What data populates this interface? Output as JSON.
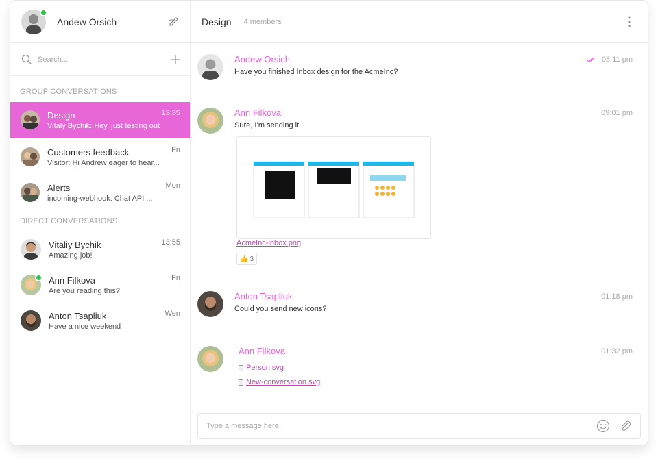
{
  "user": {
    "name": "Andew Orsich",
    "status": "online"
  },
  "search": {
    "placeholder": "Search..."
  },
  "sections": {
    "group": "GROUP CONVERSATIONS",
    "direct": "DIRECT CONVERSATIONS"
  },
  "group_conversations": [
    {
      "title": "Design",
      "subtitle": "Vitaly Bychik: Hey, just testing out",
      "time": "13:35",
      "active": true
    },
    {
      "title": "Customers feedback",
      "subtitle": "Visitor: Hi Andrew eager to hear...",
      "time": "Fri"
    },
    {
      "title": "Alerts",
      "subtitle": "incoming-webhook: Chat API ...",
      "time": "Mon"
    }
  ],
  "direct_conversations": [
    {
      "title": "Vitaliy Bychik",
      "subtitle": "Amazing job!",
      "time": "13:55"
    },
    {
      "title": "Ann Filkova",
      "subtitle": "Are you reading this?",
      "time": "Fri",
      "online": true
    },
    {
      "title": "Anton Tsapliuk",
      "subtitle": "Have a nice weekend",
      "time": "Wen"
    }
  ],
  "chat": {
    "title": "Design",
    "members": "4 members"
  },
  "messages": [
    {
      "author": "Andew Orsich",
      "time": "08:11 pm",
      "text": "Have you finished Inbox design for the AcmeInc?",
      "read": true
    },
    {
      "author": "Ann Filkova",
      "time": "09:01 pm",
      "text": "Sure, I’m sending it",
      "attachment": "AcmeInc-inbox.png",
      "reaction": {
        "emoji": "👍",
        "count": "3"
      }
    },
    {
      "author": "Anton Tsapliuk",
      "time": "01:18 pm",
      "text": "Could you send new icons?"
    },
    {
      "author": "Ann Filkova",
      "time": "01:32 pm",
      "files": [
        "Person.svg",
        "New-conversation.svg"
      ]
    }
  ],
  "composer": {
    "placeholder": "Type a message here..."
  },
  "colors": {
    "accent": "#e766d8",
    "online": "#2ac54a",
    "link": "#b14fa6"
  },
  "icons": [
    "compose-icon",
    "search-icon",
    "plus-icon",
    "kebab-menu-icon",
    "double-check-icon",
    "emoji-icon",
    "paperclip-icon",
    "file-icon"
  ]
}
